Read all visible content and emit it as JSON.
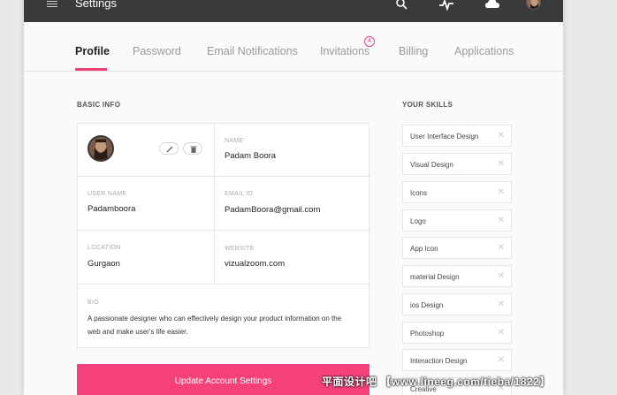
{
  "topbar": {
    "title": "Settings",
    "icons": [
      "menu-icon",
      "search-icon",
      "pulse-icon",
      "cloud-icon",
      "avatar"
    ]
  },
  "tabs": [
    {
      "label": "Profile",
      "active": true
    },
    {
      "label": "Password"
    },
    {
      "label": "Email Notifications"
    },
    {
      "label": "Invitations",
      "badge": "4"
    },
    {
      "label": "Billing"
    },
    {
      "label": "Applications"
    }
  ],
  "basic_info": {
    "heading": "BASIC INFO",
    "name_label": "NAME",
    "name": "Padam Boora",
    "username_label": "USER NAME",
    "username": "Padamboora",
    "email_label": "EMAIL ID",
    "email": "PadamBoora@gmail.com",
    "location_label": "LOCATION",
    "location": "Gurgaon",
    "website_label": "WEBSITE",
    "website": "vizualzoom.com",
    "bio_label": "BIO",
    "bio": "A passionate designer who can effectively design your product information on the web and make user's life easier."
  },
  "update_button": "Update Account Settings",
  "skills": {
    "heading": "YOUR SKILLS",
    "items": [
      "User Interface Design",
      "Visual Design",
      "Icons",
      "Logo",
      "App Icon",
      "material Design",
      "ios Design",
      "Photoshop",
      "Interaction Design",
      "Creative"
    ],
    "remove_symbol": "✕"
  },
  "watermark": "平面设计吧 【www.lineeg.com/tieba/1822】",
  "colors": {
    "topbar": "#3a3a3a",
    "accent": "#ee3f72",
    "button": "#f5417a"
  }
}
